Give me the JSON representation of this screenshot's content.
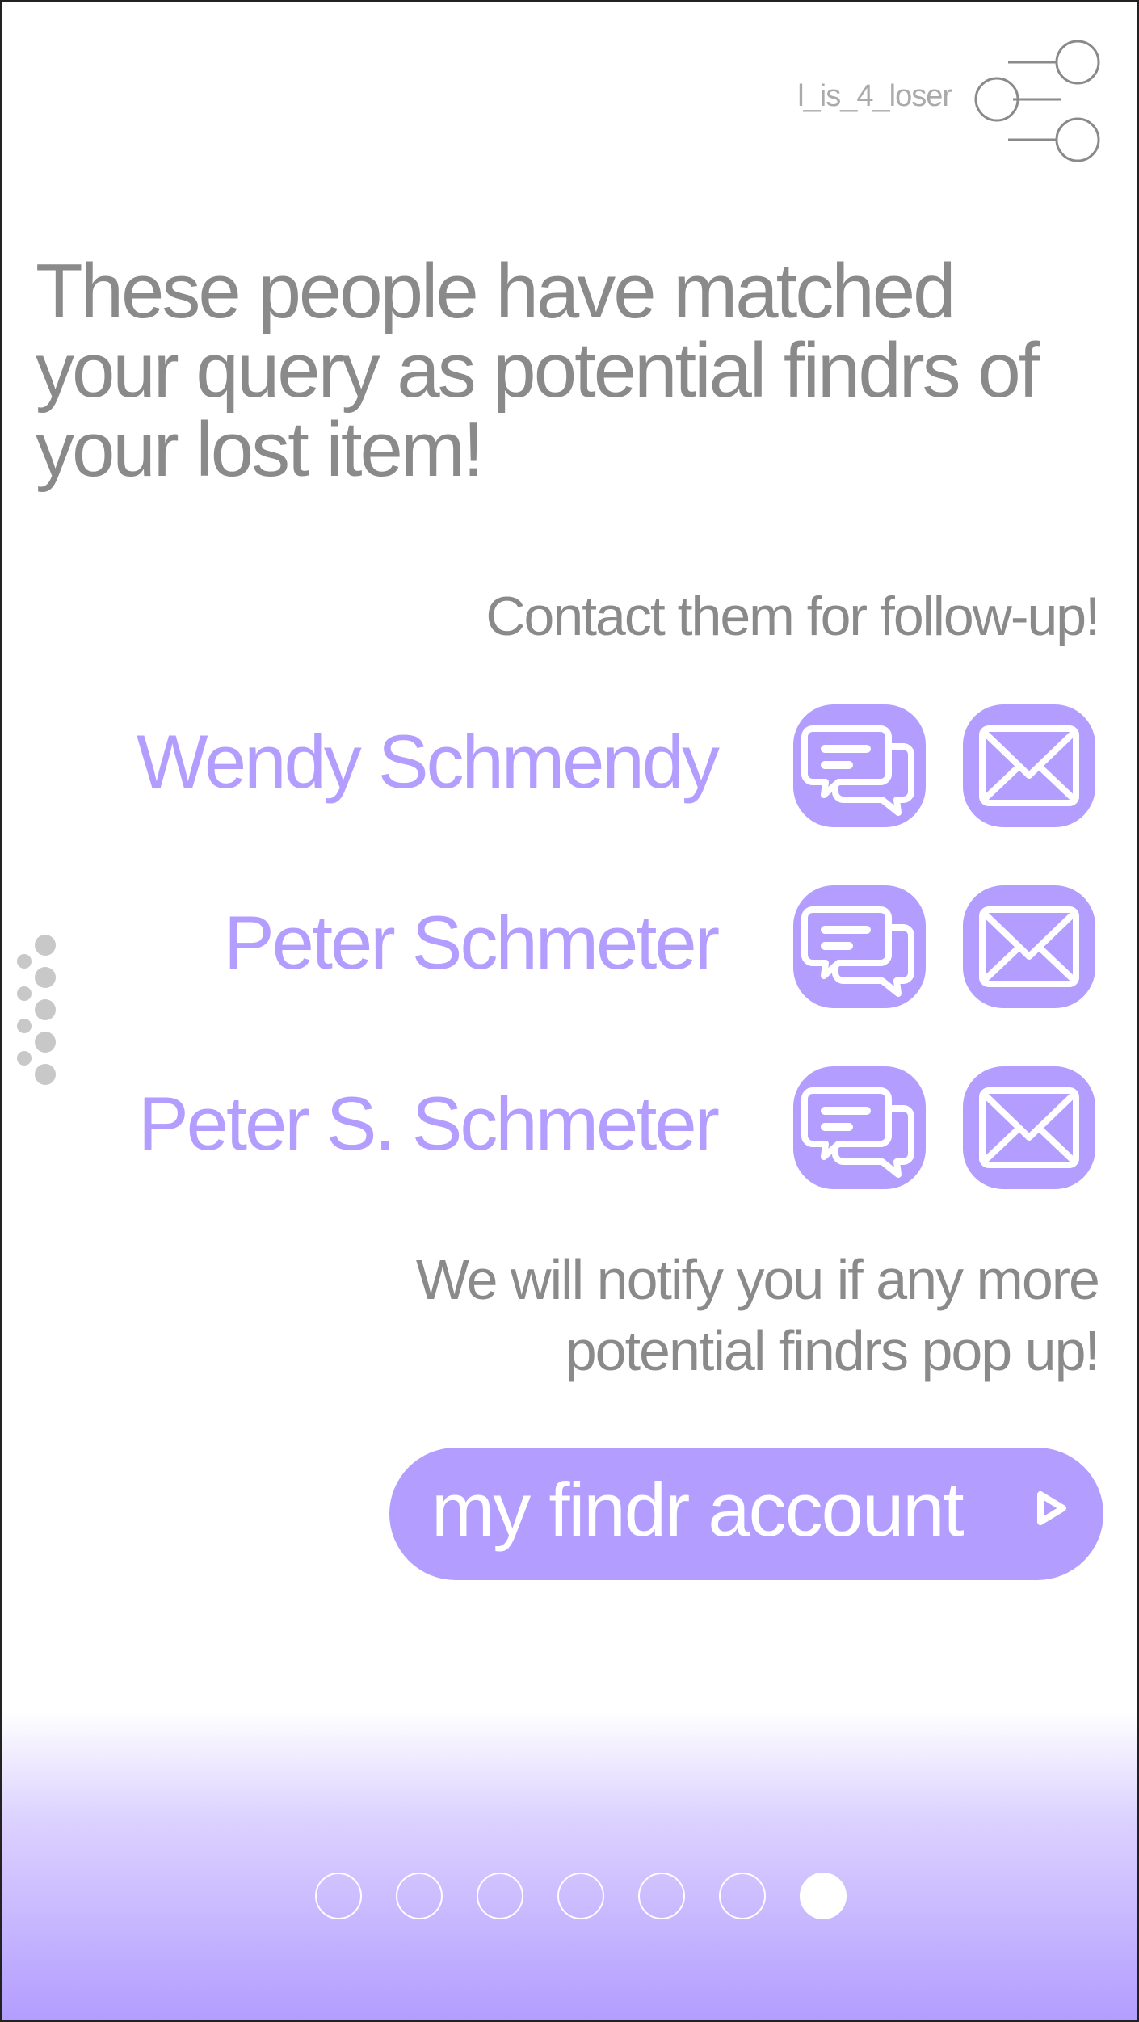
{
  "header": {
    "username": "l_is_4_loser",
    "menu_icon": "share-nodes-icon"
  },
  "headline": "These people have matched your query as potential findrs of your lost item!",
  "subhead": "Contact them for follow-up!",
  "contacts": [
    {
      "name": "Wendy Schmendy",
      "chat_icon": "chat-bubbles-icon",
      "mail_icon": "envelope-icon"
    },
    {
      "name": "Peter Schmeter",
      "chat_icon": "chat-bubbles-icon",
      "mail_icon": "envelope-icon"
    },
    {
      "name": "Peter S. Schmeter",
      "chat_icon": "chat-bubbles-icon",
      "mail_icon": "envelope-icon"
    }
  ],
  "notify_line1": "We will notify you if any more",
  "notify_line2": "potential findrs pop up!",
  "account_button": {
    "label": "my findr account",
    "icon": "play-arrow-icon"
  },
  "pagination": {
    "total": 7,
    "active": 7
  },
  "colors": {
    "accent": "#b39dff",
    "text_gray": "#8a8a8a",
    "light_gray": "#aaaaaa",
    "handle_gray": "#c8c8c8"
  }
}
